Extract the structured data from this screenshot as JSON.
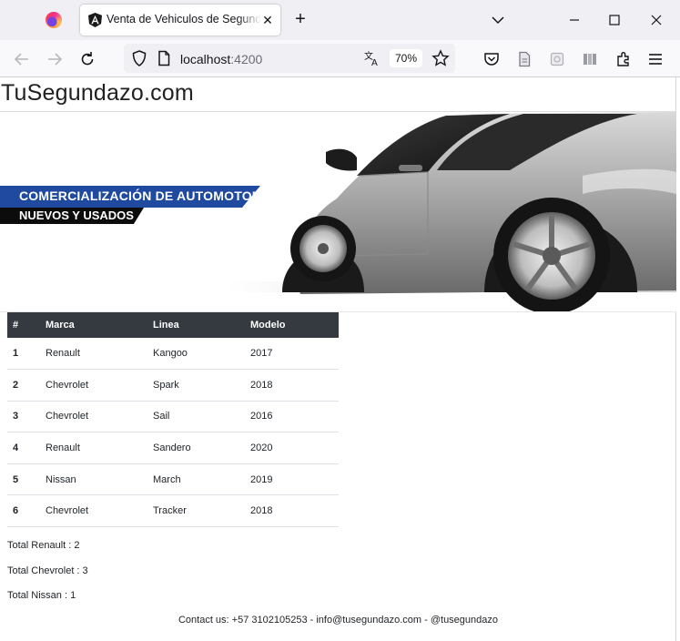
{
  "browser": {
    "tab_title": "Venta de Vehiculos de Segunda",
    "tab_icon": "angular-icon",
    "url_host": "localhost",
    "url_port": ":4200",
    "zoom": "70%"
  },
  "site": {
    "title": "TuSegundazo.com"
  },
  "banner": {
    "line1": "COMERCIALIZACIÓN DE AUTOMOTORES",
    "line2": "NUEVOS Y USADOS",
    "accent_color": "#1f4aa0"
  },
  "table": {
    "headers": [
      "#",
      "Marca",
      "Linea",
      "Modelo"
    ],
    "rows": [
      {
        "num": "1",
        "marca": "Renault",
        "linea": "Kangoo",
        "modelo": "2017"
      },
      {
        "num": "2",
        "marca": "Chevrolet",
        "linea": "Spark",
        "modelo": "2018"
      },
      {
        "num": "3",
        "marca": "Chevrolet",
        "linea": "Sail",
        "modelo": "2016"
      },
      {
        "num": "4",
        "marca": "Renault",
        "linea": "Sandero",
        "modelo": "2020"
      },
      {
        "num": "5",
        "marca": "Nissan",
        "linea": "March",
        "modelo": "2019"
      },
      {
        "num": "6",
        "marca": "Chevrolet",
        "linea": "Tracker",
        "modelo": "2018"
      }
    ]
  },
  "totals": [
    "Total Renault : 2",
    "Total Chevrolet : 3",
    "Total Nissan : 1"
  ],
  "footer": {
    "text": "Contact us: +57 3102105253 - info@tusegundazo.com - @tusegundazo"
  }
}
